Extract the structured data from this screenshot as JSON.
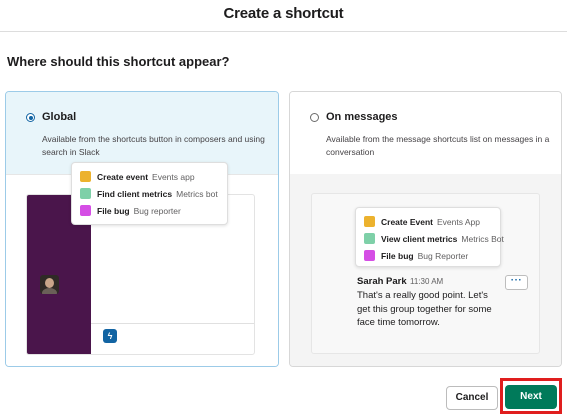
{
  "dialog": {
    "title": "Create a shortcut",
    "question": "Where should this shortcut appear?"
  },
  "options": {
    "global": {
      "label": "Global",
      "selected": true,
      "description": "Available from the shortcuts button in composers and using search in Slack",
      "menu": [
        {
          "name": "Create event",
          "app": "Events app",
          "color": "#ecb22e"
        },
        {
          "name": "Find client metrics",
          "app": "Metrics bot",
          "color": "#7ed0a8"
        },
        {
          "name": "File bug",
          "app": "Bug reporter",
          "color": "#d54ee5"
        }
      ],
      "shortcut_icon": "lightning-bolt-icon"
    },
    "messages": {
      "label": "On messages",
      "selected": false,
      "description": "Available from the message shortcuts list on messages in a conversation",
      "menu": [
        {
          "name": "Create Event",
          "app": "Events App",
          "color": "#ecb22e"
        },
        {
          "name": "View client metrics",
          "app": "Metrics Bot",
          "color": "#7ed0a8"
        },
        {
          "name": "File bug",
          "app": "Bug Reporter",
          "color": "#d54ee5"
        }
      ],
      "message": {
        "author": "Sarah Park",
        "time": "11:30 AM",
        "text": "That's a really good point. Let's get this group together for some face time tomorrow.",
        "more_icon": "ellipsis-icon"
      }
    }
  },
  "footer": {
    "cancel_label": "Cancel",
    "next_label": "Next"
  },
  "colors": {
    "accent": "#1264a3",
    "primary_button": "#007a5a",
    "highlight": "#e01e1e",
    "sidebar": "#4a154b",
    "selected_card_bg": "#e8f5fa"
  }
}
